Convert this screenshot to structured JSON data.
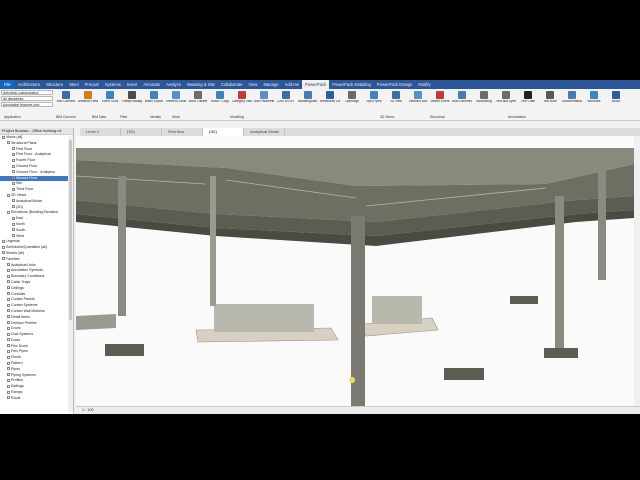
{
  "tabs": [
    "File",
    "Architecture",
    "Structure",
    "Steel",
    "Precast",
    "Systems",
    "Insert",
    "Annotate",
    "Analyze",
    "Massing & Site",
    "Collaborate",
    "View",
    "Manage",
    "Add-Ins",
    "PowerPack",
    "PowerPack Detailing",
    "PowerPack Design",
    "Modify"
  ],
  "active_tab": "PowerPack",
  "left_combos": [
    "Autodesk customization",
    "All disciplines",
    "Annotation features only"
  ],
  "ribbon_buttons": [
    {
      "label": "BIM Connect",
      "color": "#3a6ea5"
    },
    {
      "label": "Advance Design",
      "color": "#d67b1a"
    },
    {
      "label": "Event Tools",
      "color": "#3a86c4"
    },
    {
      "label": "Family Manager",
      "color": "#4a4a4a"
    },
    {
      "label": "Batch Export",
      "color": "#3a86c4"
    },
    {
      "label": "Element Lookup",
      "color": "#5a8fc8"
    },
    {
      "label": "Work Tracker",
      "color": "#6b6b6b"
    },
    {
      "label": "Move / Copy",
      "color": "#3a86c4"
    },
    {
      "label": "Category Visibility",
      "color": "#c43a3a"
    },
    {
      "label": "Add Parameters",
      "color": "#5a8fc8"
    },
    {
      "label": "CAD to RVT",
      "color": "#3a6ea5"
    },
    {
      "label": "Isolate/Ignore Geometry",
      "color": "#4a7ab0"
    },
    {
      "label": "Nestworks Clashes",
      "color": "#2a5fa0"
    },
    {
      "label": "Openings",
      "color": "#6b6b6b"
    },
    {
      "label": "Split Pipes",
      "color": "#3a86c4"
    },
    {
      "label": "3D View",
      "color": "#3a6ea5"
    },
    {
      "label": "Sections Box",
      "color": "#5a8fc8"
    },
    {
      "label": "Detect Errors",
      "color": "#c43a3a"
    },
    {
      "label": "Auto Dimensioning",
      "color": "#4a7ab0"
    },
    {
      "label": "Numbering",
      "color": "#6b6b6b"
    },
    {
      "label": "Text and Symbols",
      "color": "#6b6b6b"
    },
    {
      "label": "Text Case",
      "color": "#222222"
    },
    {
      "label": "Text Note",
      "color": "#5a5a5a"
    },
    {
      "label": "Documentation",
      "color": "#4a7ab0"
    },
    {
      "label": "Windows",
      "color": "#3a86c4"
    },
    {
      "label": "About",
      "color": "#2a5fa0"
    }
  ],
  "panel_titles": [
    "Application",
    "BIM Connect",
    "BIM Data",
    "Files",
    "Identity",
    "Work",
    "Modeling",
    "3D Views",
    "Structural",
    "Annotations"
  ],
  "view_tabs": [
    "Level 2",
    "{3D}",
    "First floor",
    "{3D}",
    "Analytical Model"
  ],
  "active_view_tab": 3,
  "browser": {
    "title": "Project Browser - Office building.rvt",
    "rows": [
      {
        "text": "Views (all)",
        "indent": 0,
        "sel": false
      },
      {
        "text": "Structural Plans",
        "indent": 1,
        "sel": false
      },
      {
        "text": "First Floor",
        "indent": 2,
        "sel": false
      },
      {
        "text": "First Floor - Analytical",
        "indent": 2,
        "sel": false
      },
      {
        "text": "Fourth Floor",
        "indent": 2,
        "sel": false
      },
      {
        "text": "Ground Floor",
        "indent": 2,
        "sel": false
      },
      {
        "text": "Ground Floor - Analytica",
        "indent": 2,
        "sel": false
      },
      {
        "text": "Second Floor",
        "indent": 2,
        "sel": true
      },
      {
        "text": "Site",
        "indent": 2,
        "sel": false
      },
      {
        "text": "Third Floor",
        "indent": 2,
        "sel": false
      },
      {
        "text": "3D Views",
        "indent": 1,
        "sel": false
      },
      {
        "text": "Analytical Model",
        "indent": 2,
        "sel": false
      },
      {
        "text": "{3D}",
        "indent": 2,
        "sel": false
      },
      {
        "text": "Elevations (Building Elevation",
        "indent": 1,
        "sel": false
      },
      {
        "text": "East",
        "indent": 2,
        "sel": false
      },
      {
        "text": "North",
        "indent": 2,
        "sel": false
      },
      {
        "text": "South",
        "indent": 2,
        "sel": false
      },
      {
        "text": "West",
        "indent": 2,
        "sel": false
      },
      {
        "text": "Legends",
        "indent": 0,
        "sel": false
      },
      {
        "text": "Schedules/Quantities (all)",
        "indent": 0,
        "sel": false
      },
      {
        "text": "Sheets (all)",
        "indent": 0,
        "sel": false
      },
      {
        "text": "Families",
        "indent": 0,
        "sel": false
      },
      {
        "text": "Analytical Links",
        "indent": 1,
        "sel": false
      },
      {
        "text": "Annotation Symbols",
        "indent": 1,
        "sel": false
      },
      {
        "text": "Boundary Conditions",
        "indent": 1,
        "sel": false
      },
      {
        "text": "Cable Trays",
        "indent": 1,
        "sel": false
      },
      {
        "text": "Ceilings",
        "indent": 1,
        "sel": false
      },
      {
        "text": "Conduits",
        "indent": 1,
        "sel": false
      },
      {
        "text": "Curtain Panels",
        "indent": 1,
        "sel": false
      },
      {
        "text": "Curtain Systems",
        "indent": 1,
        "sel": false
      },
      {
        "text": "Curtain Wall Mullions",
        "indent": 1,
        "sel": false
      },
      {
        "text": "Detail Items",
        "indent": 1,
        "sel": false
      },
      {
        "text": "Division Profiles",
        "indent": 1,
        "sel": false
      },
      {
        "text": "Doors",
        "indent": 1,
        "sel": false
      },
      {
        "text": "Duct Systems",
        "indent": 1,
        "sel": false
      },
      {
        "text": "Ducts",
        "indent": 1,
        "sel": false
      },
      {
        "text": "Flex Ducts",
        "indent": 1,
        "sel": false
      },
      {
        "text": "Flex Pipes",
        "indent": 1,
        "sel": false
      },
      {
        "text": "Floors",
        "indent": 1,
        "sel": false
      },
      {
        "text": "Pattern",
        "indent": 1,
        "sel": false
      },
      {
        "text": "Pipes",
        "indent": 1,
        "sel": false
      },
      {
        "text": "Piping Systems",
        "indent": 1,
        "sel": false
      },
      {
        "text": "Profiles",
        "indent": 1,
        "sel": false
      },
      {
        "text": "Railings",
        "indent": 1,
        "sel": false
      },
      {
        "text": "Ramps",
        "indent": 1,
        "sel": false
      },
      {
        "text": "Roofs",
        "indent": 1,
        "sel": false
      }
    ]
  },
  "status_scale": "1 : 100"
}
